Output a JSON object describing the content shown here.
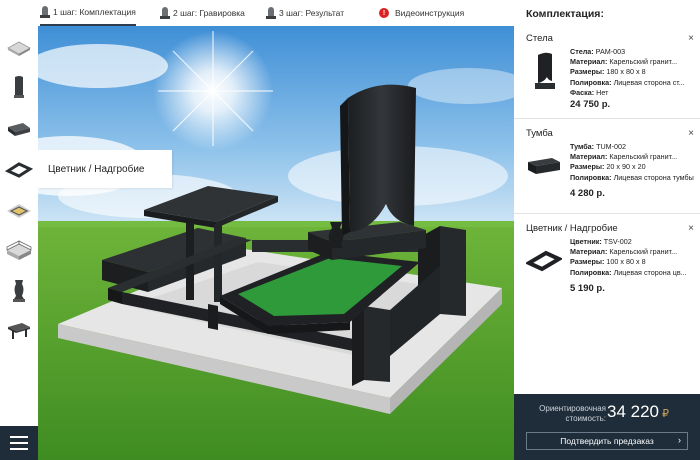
{
  "steps": [
    {
      "label": "1 шаг: Комплектация",
      "active": true
    },
    {
      "label": "2 шаг: Гравировка",
      "active": false
    },
    {
      "label": "3 шаг: Результат",
      "active": false
    }
  ],
  "video": {
    "label": "Видеоинструкция",
    "icon": "exclamation-icon"
  },
  "left_tools": {
    "icons": [
      "base-slab-icon",
      "stele-icon",
      "pedestal-icon",
      "flowerbed-icon",
      "frame-icon",
      "fence-icon",
      "vase-icon",
      "bench-icon"
    ],
    "active_tooltip": "Цветник / Надгробие"
  },
  "panel": {
    "title": "Комплектация:",
    "items": [
      {
        "heading": "Стела",
        "props": [
          {
            "k": "Стела:",
            "v": "РАМ-003"
          },
          {
            "k": "Материал:",
            "v": "Карельский гранит..."
          },
          {
            "k": "Размеры:",
            "v": "180 х 80 х 8"
          },
          {
            "k": "Полировка:",
            "v": "Лицевая сторона ст..."
          },
          {
            "k": "Фаска:",
            "v": "Нет"
          }
        ],
        "price": "24 750 р."
      },
      {
        "heading": "Тумба",
        "props": [
          {
            "k": "Тумба:",
            "v": "TUM-002"
          },
          {
            "k": "Материал:",
            "v": "Карельский гранит..."
          },
          {
            "k": "Размеры:",
            "v": "20 х 90 х 20"
          },
          {
            "k": "Полировка:",
            "v": "Лицевая сторона тумбы"
          }
        ],
        "price": "4 280 р."
      },
      {
        "heading": "Цветник / Надгробие",
        "props": [
          {
            "k": "Цветник:",
            "v": "TSV-002"
          },
          {
            "k": "Материал:",
            "v": "Карельский гранит..."
          },
          {
            "k": "Размеры:",
            "v": "100 х 80 х 8"
          },
          {
            "k": "Полировка:",
            "v": "Лицевая сторона цв..."
          }
        ],
        "price": "5 190 р."
      }
    ],
    "close_glyph": "×"
  },
  "total": {
    "label": "Ориентировочная стоимость:",
    "value": "34 220",
    "currency": "₽",
    "confirm_label": "Подтвердить предзаказ",
    "confirm_arrow": "›"
  },
  "colors": {
    "dark_navy": "#1f2d3a",
    "granite": "#2b2e31",
    "grass": "#4c9a2a",
    "sky": "#5aa2dd",
    "flowerbed_green": "#2e9a3a",
    "currency_gold": "#c9a45a",
    "video_red": "#dd2222"
  }
}
